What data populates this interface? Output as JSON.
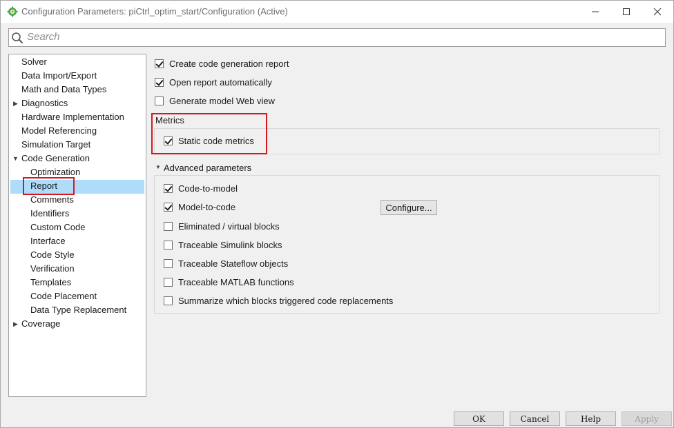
{
  "window": {
    "title": "Configuration Parameters: piCtrl_optim_start/Configuration (Active)"
  },
  "search": {
    "placeholder": "Search",
    "value": ""
  },
  "tree": {
    "items": [
      {
        "label": "Solver"
      },
      {
        "label": "Data Import/Export"
      },
      {
        "label": "Math and Data Types"
      },
      {
        "label": "Diagnostics"
      },
      {
        "label": "Hardware Implementation"
      },
      {
        "label": "Model Referencing"
      },
      {
        "label": "Simulation Target"
      },
      {
        "label": "Code Generation"
      },
      {
        "label": "Optimization"
      },
      {
        "label": "Report"
      },
      {
        "label": "Comments"
      },
      {
        "label": "Identifiers"
      },
      {
        "label": "Custom Code"
      },
      {
        "label": "Interface"
      },
      {
        "label": "Code Style"
      },
      {
        "label": "Verification"
      },
      {
        "label": "Templates"
      },
      {
        "label": "Code Placement"
      },
      {
        "label": "Data Type Replacement"
      },
      {
        "label": "Coverage"
      }
    ],
    "selected": "Report"
  },
  "report": {
    "create_report": {
      "label": "Create code generation report",
      "checked": true
    },
    "open_report": {
      "label": "Open report automatically",
      "checked": true
    },
    "web_view": {
      "label": "Generate model Web view",
      "checked": false
    },
    "metrics_group": "Metrics",
    "static_metrics": {
      "label": "Static code metrics",
      "checked": true
    },
    "advanced_group": "Advanced parameters",
    "code_to_model": {
      "label": "Code-to-model",
      "checked": true
    },
    "model_to_code": {
      "label": "Model-to-code",
      "checked": true
    },
    "configure_label": "Configure...",
    "eliminated_blocks": {
      "label": "Eliminated / virtual blocks",
      "checked": false
    },
    "traceable_simulink": {
      "label": "Traceable Simulink blocks",
      "checked": false
    },
    "traceable_stateflow": {
      "label": "Traceable Stateflow objects",
      "checked": false
    },
    "traceable_matlab": {
      "label": "Traceable MATLAB functions",
      "checked": false
    },
    "summarize_blocks": {
      "label": "Summarize which blocks triggered code replacements",
      "checked": false
    }
  },
  "buttons": {
    "ok": "OK",
    "cancel": "Cancel",
    "help": "Help",
    "apply": "Apply"
  },
  "colors": {
    "selection": "#aedcfa",
    "highlight_box": "#d6181e"
  }
}
